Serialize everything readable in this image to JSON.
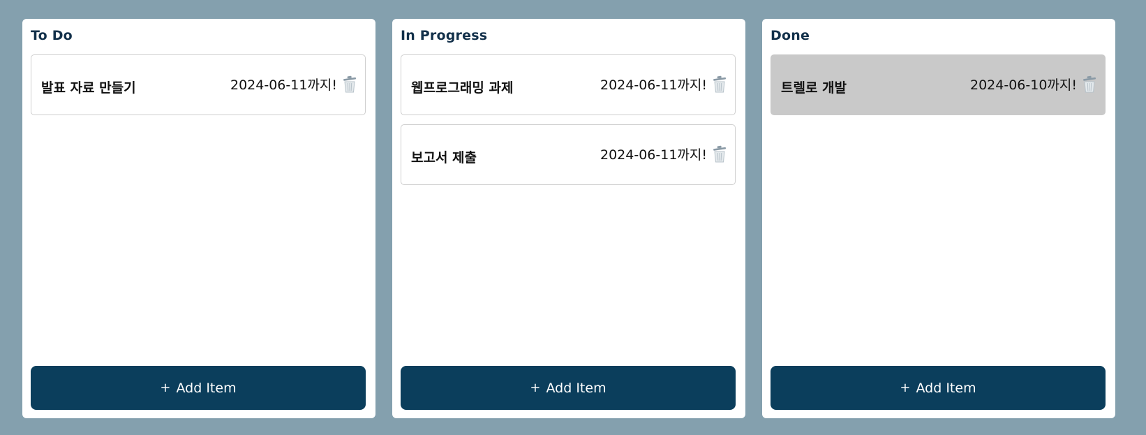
{
  "columns": [
    {
      "title": "To Do",
      "add_label": "Add Item",
      "add_icon": "+",
      "cards": [
        {
          "title": "발표 자료 만들기",
          "due": "2024-06-11까지!",
          "done": false
        }
      ]
    },
    {
      "title": "In Progress",
      "add_label": "Add Item",
      "add_icon": "+",
      "cards": [
        {
          "title": "웹프로그래밍 과제",
          "due": "2024-06-11까지!",
          "done": false
        },
        {
          "title": "보고서 제출",
          "due": "2024-06-11까지!",
          "done": false
        }
      ]
    },
    {
      "title": "Done",
      "add_label": "Add Item",
      "add_icon": "+",
      "cards": [
        {
          "title": "트렐로 개발",
          "due": "2024-06-10까지!",
          "done": true
        }
      ]
    }
  ],
  "colors": {
    "background": "#84a0ae",
    "button": "#0b3e5c",
    "done_card": "#c9c9c9"
  }
}
